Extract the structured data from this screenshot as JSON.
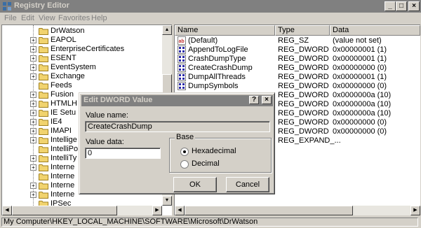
{
  "window": {
    "title": "Registry Editor",
    "minimize_glyph": "_",
    "maximize_glyph": "□",
    "close_glyph": "×"
  },
  "menu": [
    "File",
    "Edit",
    "View",
    "Favorites",
    "Help"
  ],
  "tree": {
    "items": [
      {
        "label": "DrWatson",
        "expander": ""
      },
      {
        "label": "EAPOL",
        "expander": "+"
      },
      {
        "label": "EnterpriseCertificates",
        "expander": "+"
      },
      {
        "label": "ESENT",
        "expander": "+"
      },
      {
        "label": "EventSystem",
        "expander": "+"
      },
      {
        "label": "Exchange",
        "expander": "+"
      },
      {
        "label": "Feeds",
        "expander": ""
      },
      {
        "label": "Fusion",
        "expander": "+"
      },
      {
        "label": "HTMLH",
        "expander": "+"
      },
      {
        "label": "IE Setu",
        "expander": "+"
      },
      {
        "label": "IE4",
        "expander": "+"
      },
      {
        "label": "IMAPI",
        "expander": "+"
      },
      {
        "label": "Intellige",
        "expander": "+"
      },
      {
        "label": "IntelliPo",
        "expander": ""
      },
      {
        "label": "IntelliTy",
        "expander": "+"
      },
      {
        "label": "Interne",
        "expander": "+"
      },
      {
        "label": "Interne",
        "expander": ""
      },
      {
        "label": "Interne",
        "expander": "+"
      },
      {
        "label": "Interne",
        "expander": "+"
      },
      {
        "label": "IPSec",
        "expander": ""
      }
    ]
  },
  "list": {
    "columns": {
      "name": "Name",
      "type": "Type",
      "data": "Data"
    },
    "rows": [
      {
        "icon": "string-value-icon",
        "name": "(Default)",
        "type": "REG_SZ",
        "data": "(value not set)"
      },
      {
        "icon": "dword-value-icon",
        "name": "AppendToLogFile",
        "type": "REG_DWORD",
        "data": "0x00000001 (1)"
      },
      {
        "icon": "dword-value-icon",
        "name": "CrashDumpType",
        "type": "REG_DWORD",
        "data": "0x00000001 (1)"
      },
      {
        "icon": "dword-value-icon",
        "name": "CreateCrashDump",
        "type": "REG_DWORD",
        "data": "0x00000000 (0)"
      },
      {
        "icon": "dword-value-icon",
        "name": "DumpAllThreads",
        "type": "REG_DWORD",
        "data": "0x00000001 (1)"
      },
      {
        "icon": "dword-value-icon",
        "name": "DumpSymbols",
        "type": "REG_DWORD",
        "data": "0x00000000 (0)"
      },
      {
        "icon": "",
        "name": "",
        "type": "REG_DWORD",
        "data": "0x0000000a (10)"
      },
      {
        "icon": "",
        "name": "",
        "type": "REG_DWORD",
        "data": "0x0000000a (10)"
      },
      {
        "icon": "",
        "name": "",
        "type": "REG_DWORD",
        "data": "0x0000000a (10)"
      },
      {
        "icon": "",
        "name": "",
        "type": "REG_DWORD",
        "data": "0x00000000 (0)"
      },
      {
        "icon": "",
        "name": "",
        "type": "REG_DWORD",
        "data": "0x00000000 (0)"
      },
      {
        "icon": "",
        "name": "",
        "type": "REG_EXPAND_...",
        "data": ""
      }
    ]
  },
  "status": {
    "path": "My Computer\\HKEY_LOCAL_MACHINE\\SOFTWARE\\Microsoft\\DrWatson"
  },
  "dialog": {
    "title": "Edit DWORD Value",
    "help_glyph": "?",
    "close_glyph": "×",
    "value_name_label": "Value name:",
    "value_name": "CreateCrashDump",
    "value_data_label": "Value data:",
    "value_data": "0",
    "base_label": "Base",
    "hex_label": "Hexadecimal",
    "dec_label": "Decimal",
    "base_selected": "Hexadecimal",
    "ok_label": "OK",
    "cancel_label": "Cancel"
  },
  "colors": {
    "face": "#d4d0c8",
    "inactive_title": "#808080",
    "folder": "#f1d36e",
    "dword_icon": "#2a2aa8",
    "string_icon": "#c03030"
  }
}
